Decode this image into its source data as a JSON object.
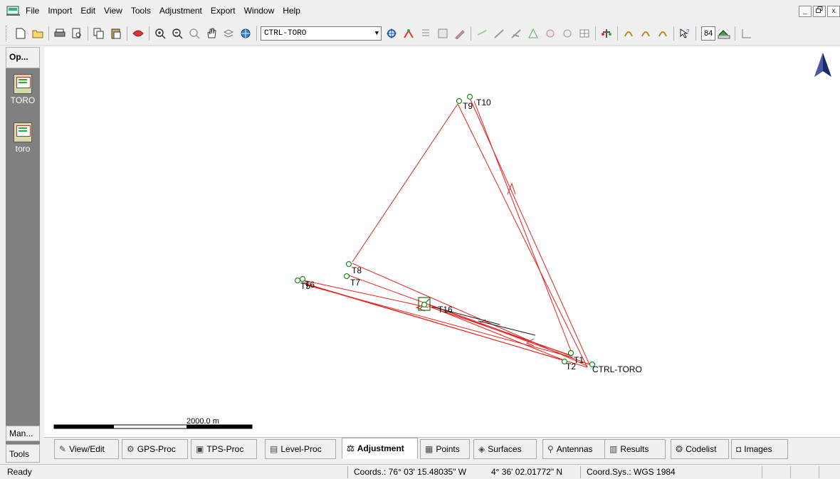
{
  "menu": {
    "items": [
      "File",
      "Import",
      "Edit",
      "View",
      "Tools",
      "Adjustment",
      "Export",
      "Window",
      "Help"
    ]
  },
  "window_controls": {
    "minimize": "_",
    "restore": "ř",
    "close": "x"
  },
  "toolbar": {
    "project_combo": "CTRL-TORO",
    "number_value": "84"
  },
  "sidebar": {
    "header": "Op...",
    "items": [
      {
        "label": "TORO"
      },
      {
        "label": "toro"
      }
    ],
    "bottom_tabs": [
      "Man...",
      "Tools"
    ]
  },
  "map": {
    "scale_label": "2000.0 m",
    "points": [
      {
        "name": "T10"
      },
      {
        "name": "T9"
      },
      {
        "name": "T8"
      },
      {
        "name": "T7"
      },
      {
        "name": "T5"
      },
      {
        "name": "T6"
      },
      {
        "name": "T16"
      },
      {
        "name": "T2"
      },
      {
        "name": "T1"
      },
      {
        "name": "CTRL-TORO"
      }
    ],
    "line_color": "#e8201c",
    "point_color": "#1f8a1f"
  },
  "tabs": [
    {
      "label": "View/Edit",
      "icon": "view-edit-icon"
    },
    {
      "label": "GPS-Proc",
      "icon": "gps-proc-icon"
    },
    {
      "label": "TPS-Proc",
      "icon": "tps-proc-icon"
    },
    {
      "label": "Level-Proc",
      "icon": "level-proc-icon"
    },
    {
      "label": "Adjustment",
      "icon": "adjustment-icon",
      "active": true
    },
    {
      "label": "Points",
      "icon": "points-icon"
    },
    {
      "label": "Surfaces",
      "icon": "surfaces-icon"
    },
    {
      "label": "Antennas",
      "icon": "antennas-icon"
    },
    {
      "label": "Results",
      "icon": "results-icon"
    },
    {
      "label": "Codelist",
      "icon": "codelist-icon"
    },
    {
      "label": "Images",
      "icon": "images-icon"
    }
  ],
  "status": {
    "ready": "Ready",
    "coords": "Coords.:  76° 03' 15.48035\" W",
    "lat": "4° 36' 02.01772\" N",
    "coord_sys": "Coord.Sys.: WGS 1984"
  }
}
